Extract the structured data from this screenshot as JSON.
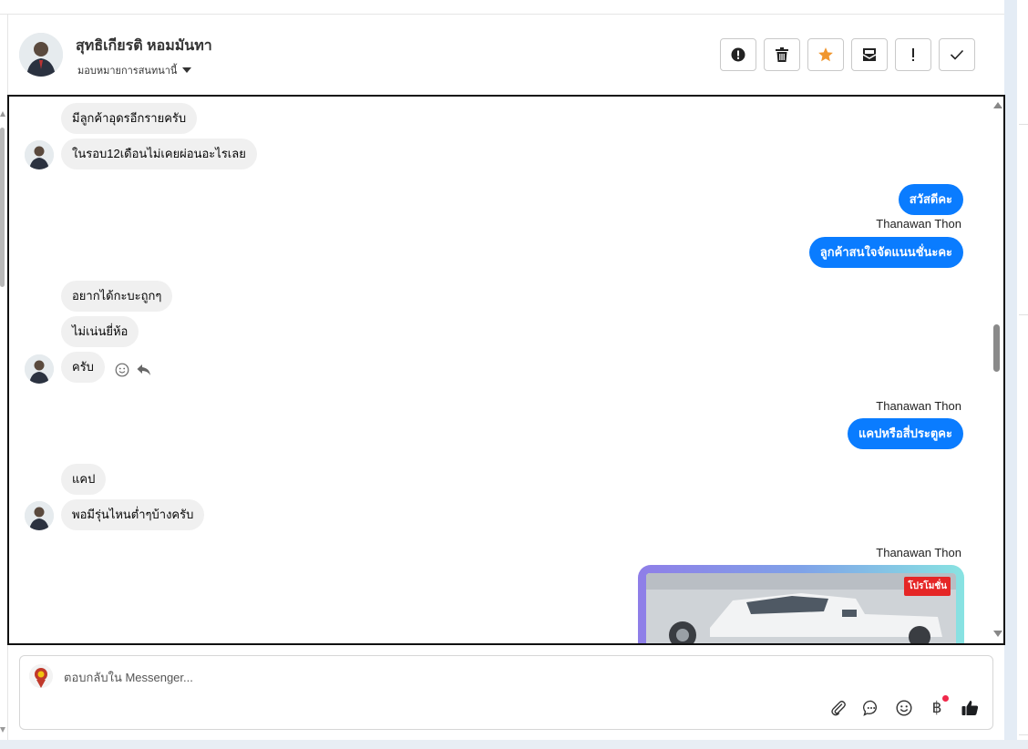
{
  "header": {
    "contact_name": "สุทธิเกียรติ หอมมันทา",
    "assign_label": "มอบหมายการสนทนานี้",
    "actions": [
      {
        "name": "spam-button",
        "icon": "alert-circle-icon"
      },
      {
        "name": "delete-button",
        "icon": "trash-icon"
      },
      {
        "name": "star-button",
        "icon": "star-icon",
        "color": "#f0962e"
      },
      {
        "name": "mark-unread-button",
        "icon": "envelope-icon"
      },
      {
        "name": "follow-up-button",
        "icon": "exclamation-icon"
      },
      {
        "name": "mark-done-button",
        "icon": "check-icon"
      }
    ]
  },
  "conversation": {
    "outgoing_color": "#0a7cff",
    "incoming_color": "#f0f0f0",
    "messages": [
      {
        "dir": "in",
        "text": "มีลูกค้าอุดรอีกรายครับ"
      },
      {
        "dir": "in",
        "text": "ในรอบ12เดือนไม่เคยผ่อนอะไรเลย"
      },
      {
        "dir": "out",
        "text": "สวัสดีคะ"
      },
      {
        "dir": "sender",
        "text": "Thanawan Thon"
      },
      {
        "dir": "out",
        "text": "ลูกค้าสนใจจัดแนนชั่นะคะ"
      },
      {
        "dir": "in",
        "text": "อยากได้กะบะถูกๆ"
      },
      {
        "dir": "in",
        "text": "ไม่เน่นยี่ห้อ"
      },
      {
        "dir": "in",
        "text": "ครับ"
      },
      {
        "dir": "sender",
        "text": "Thanawan Thon"
      },
      {
        "dir": "out",
        "text": "แคปหรือสี่ประตูคะ"
      },
      {
        "dir": "in",
        "text": "แคป"
      },
      {
        "dir": "in",
        "text": "พอมีรุ่นไหนต่ำๆบ้างครับ"
      },
      {
        "dir": "sender",
        "text": "Thanawan Thon"
      }
    ],
    "promo_label": "โปรโมชั่น"
  },
  "composer": {
    "placeholder": "ตอบกลับใน Messenger...",
    "tools": [
      "paperclip-icon",
      "chat-bubble-icon",
      "smile-icon",
      "baht-icon",
      "thumbs-up-icon"
    ],
    "baht_symbol": "฿"
  }
}
